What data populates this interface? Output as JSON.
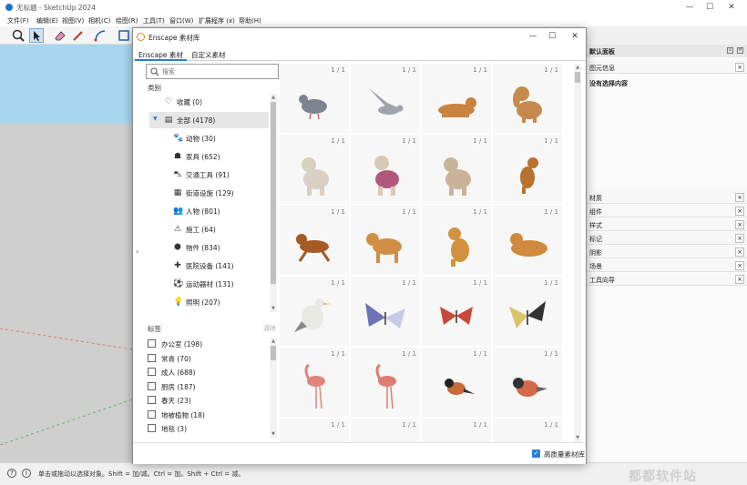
{
  "app": {
    "title": "无标题 - SketchUp 2024",
    "menu": [
      "文件(F)",
      "编辑(E)",
      "视图(V)",
      "相机(C)",
      "绘图(R)",
      "工具(T)",
      "窗口(W)",
      "扩展程序 (x)",
      "帮助(H)"
    ],
    "win_minimize": "—",
    "win_maximize": "☐",
    "win_close": "✕"
  },
  "tray": {
    "title": "默认面板",
    "entity_info": "图元信息",
    "no_selection": "没有选择内容",
    "sections": [
      "材质",
      "组件",
      "样式",
      "标记",
      "阴影",
      "场景",
      "工具向导"
    ]
  },
  "status": {
    "text": "单击或拖动以选择对象。Shift = 加/减。Ctrl = 加。Shift + Ctrl = 减。",
    "watermark": "都都软件站"
  },
  "dialog": {
    "title": "Enscape 素材库",
    "minimize": "—",
    "maximize": "☐",
    "close": "✕",
    "tabs": [
      "Enscape 素材",
      "自定义素材"
    ],
    "search_placeholder": "搜索",
    "categories_label": "类别",
    "tags_label": "标签",
    "tags_clear": "清除",
    "categories": [
      {
        "icon": "♡",
        "label": "收藏 (0)",
        "indent": false
      },
      {
        "icon": "▤",
        "label": "全部 (4178)",
        "indent": false,
        "selected": true,
        "expanded": true
      },
      {
        "icon": "🐾",
        "label": "动物 (30)",
        "indent": true
      },
      {
        "icon": "☗",
        "label": "家具 (652)",
        "indent": true
      },
      {
        "icon": "⛍",
        "label": "交通工具 (91)",
        "indent": true
      },
      {
        "icon": "▦",
        "label": "街道设施 (129)",
        "indent": true
      },
      {
        "icon": "👥",
        "label": "人物 (801)",
        "indent": true
      },
      {
        "icon": "⚠",
        "label": "施工 (64)",
        "indent": true
      },
      {
        "icon": "⬢",
        "label": "物件 (834)",
        "indent": true
      },
      {
        "icon": "✚",
        "label": "医院设备 (141)",
        "indent": true
      },
      {
        "icon": "⚽",
        "label": "运动器材 (131)",
        "indent": true
      },
      {
        "icon": "💡",
        "label": "照明 (207)",
        "indent": true
      }
    ],
    "tags": [
      "办公室 (198)",
      "常青 (70)",
      "成人 (688)",
      "厨房 (187)",
      "春天 (23)",
      "地被植物 (18)",
      "地毯 (3)"
    ],
    "grid_count": "1 / 1",
    "assets": [
      {
        "kind": "pigeon",
        "color": "#7d8391"
      },
      {
        "kind": "pigeon-fly",
        "color": "#9ea3ab"
      },
      {
        "kind": "dog-lying",
        "color": "#c9833f"
      },
      {
        "kind": "spaniel",
        "color": "#c58a4c"
      },
      {
        "kind": "poodle",
        "color": "#d9cfc2"
      },
      {
        "kind": "poodle-pink",
        "color": "#d8c8b6"
      },
      {
        "kind": "poodle",
        "color": "#c9b49a"
      },
      {
        "kind": "dog-sit",
        "color": "#b8712f"
      },
      {
        "kind": "dog-run",
        "color": "#a65b25"
      },
      {
        "kind": "retriever",
        "color": "#d08f45"
      },
      {
        "kind": "retriever-sit",
        "color": "#d2923f"
      },
      {
        "kind": "retriever-lie",
        "color": "#cf8a3e"
      },
      {
        "kind": "gull",
        "color": "#e9e9e4"
      },
      {
        "kind": "butterfly-blue",
        "color": "#6f73b5"
      },
      {
        "kind": "butterfly-red",
        "color": "#c84a3a"
      },
      {
        "kind": "butterfly-yellow",
        "color": "#d8c56a"
      },
      {
        "kind": "flamingo",
        "color": "#e0857a"
      },
      {
        "kind": "flamingo",
        "color": "#dd7c72"
      },
      {
        "kind": "bird-small",
        "color": "#c96a3a"
      },
      {
        "kind": "bullfinch",
        "color": "#d46a4c"
      },
      {
        "kind": "blank",
        "color": "#dddddd"
      },
      {
        "kind": "blank",
        "color": "#dddddd"
      },
      {
        "kind": "blank",
        "color": "#dddddd"
      },
      {
        "kind": "butterfly-yellow",
        "color": "#c8bda0"
      }
    ],
    "high_quality_label": "高质量素材库"
  }
}
